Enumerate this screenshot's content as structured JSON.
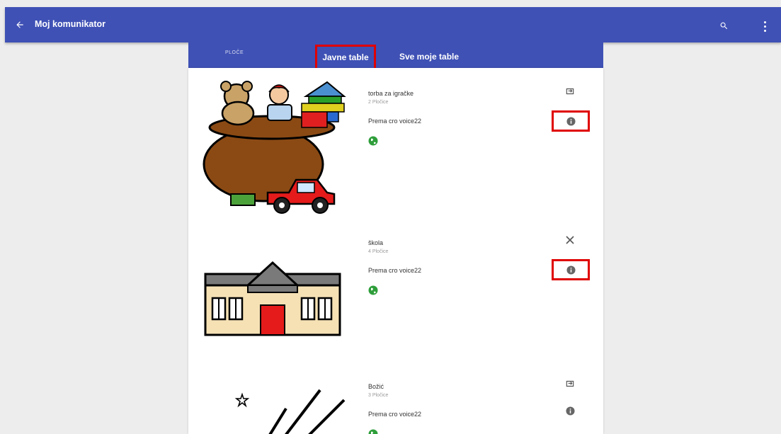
{
  "appbar": {
    "title": "Moj komunikator",
    "back_icon": "arrow-left-icon",
    "search_icon": "search-icon",
    "menu_icon": "more-vert-icon",
    "color": "#3f51b5"
  },
  "tabs": {
    "ploce": "PLOČE",
    "javne": "Javne table",
    "sve": "Sve moje table",
    "highlight_color": "#e00000"
  },
  "boards": [
    {
      "name": "torba za igračke",
      "count": "2 Pločice",
      "owner": "Prema cro voice22",
      "action_icon": "open-in-icon",
      "info_icon": "info-icon",
      "public_icon": "globe-icon"
    },
    {
      "name": "škola",
      "count": "4 Pločice",
      "owner": "Prema cro voice22",
      "action_icon": "close-icon",
      "info_icon": "info-icon",
      "public_icon": "globe-icon"
    },
    {
      "name": "Božić",
      "count": "3 Pločice",
      "owner": "Prema cro voice22",
      "action_icon": "open-in-icon",
      "info_icon": "info-icon",
      "public_icon": "globe-icon"
    }
  ]
}
